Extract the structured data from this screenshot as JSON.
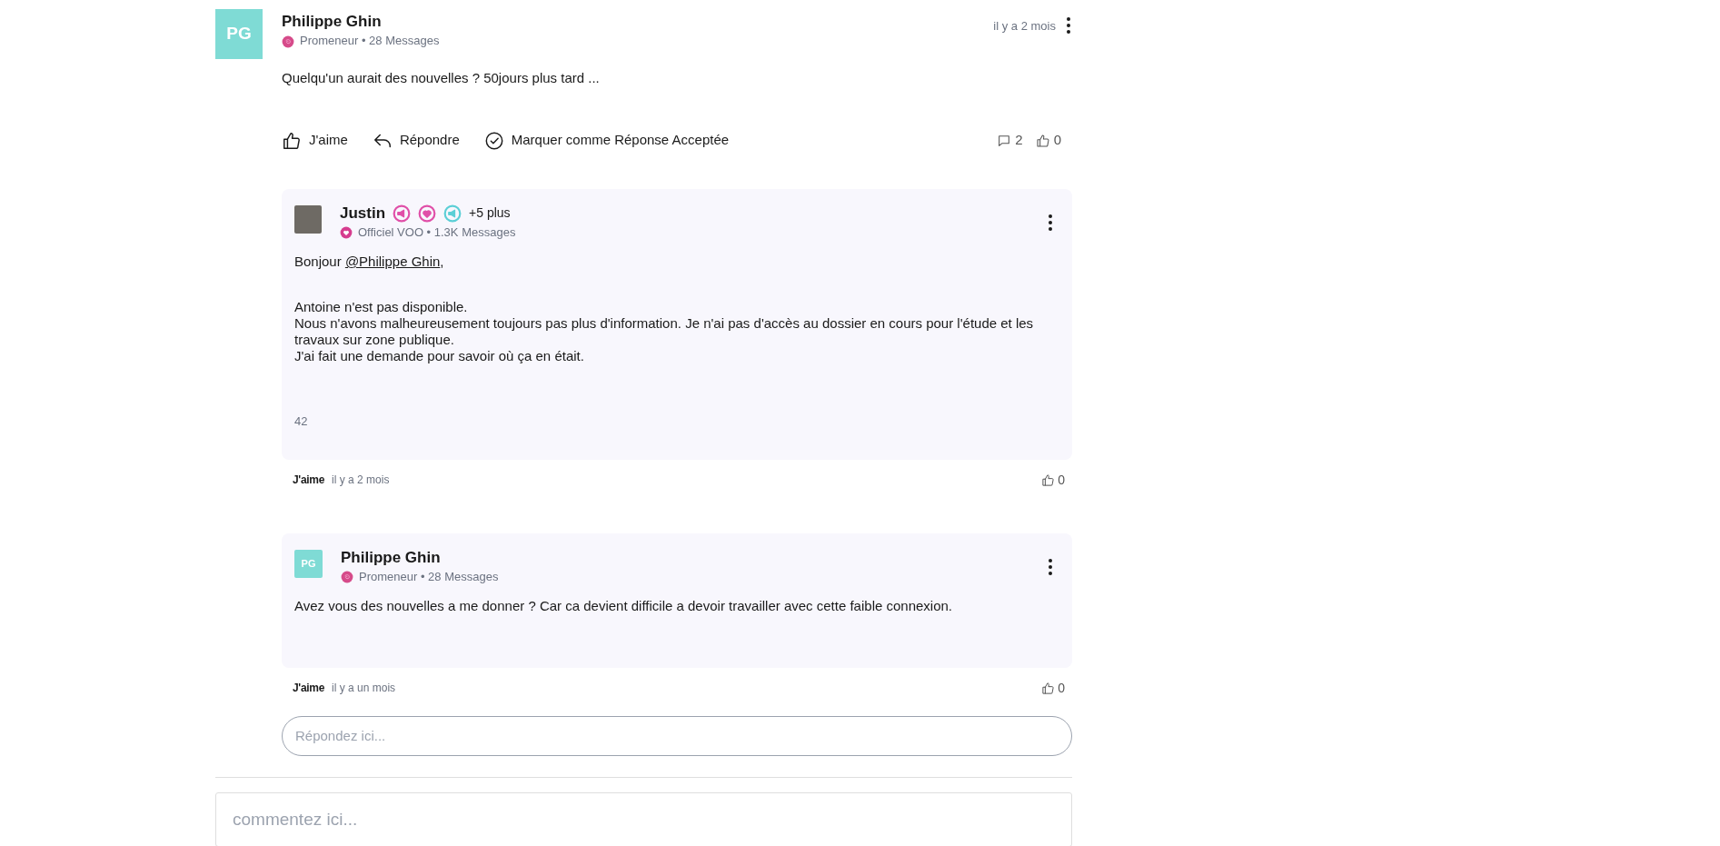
{
  "post": {
    "avatar_initials": "PG",
    "author": "Philippe Ghin",
    "role": "Promeneur • 28 Messages",
    "time": "il y a 2 mois",
    "text": "Quelqu'un aurait des nouvelles ? 50jours plus tard ...",
    "actions": [
      {
        "kind": "like",
        "label": "J'aime"
      },
      {
        "kind": "reply",
        "label": "Répondre"
      },
      {
        "kind": "accept",
        "label": "Marquer comme Réponse Acceptée"
      }
    ],
    "comment_count": "2",
    "like_count": "0"
  },
  "replies": [
    {
      "avatar": {
        "kind": "photo"
      },
      "author": "Justin",
      "badges": [
        {
          "kind": "megaphone",
          "color": "#e04fa8"
        },
        {
          "kind": "heart",
          "color": "#e04fa8"
        },
        {
          "kind": "megaphone",
          "color": "#5ccfd6"
        }
      ],
      "more_badges": "+5 plus",
      "rank_badge": {
        "kind": "heart"
      },
      "role": "Officiel VOO • 1.3K Messages",
      "greeting": {
        "before": "Bonjour ",
        "mention": "@Philippe Ghin",
        "after": ","
      },
      "lines": [
        "Antoine n'est pas disponible.",
        "Nous n'avons malheureusement toujours pas plus d'information. Je n'ai pas d'accès au dossier en cours pour l'étude et les travaux sur zone publique.",
        "J'ai fait une demande pour savoir où ça en était."
      ],
      "note": "42",
      "like_label": "J'aime",
      "time": "il y a 2 mois",
      "like_count": "0"
    },
    {
      "avatar": {
        "kind": "initials",
        "initials": "PG"
      },
      "author": "Philippe Ghin",
      "rank_badge": {
        "kind": "swirl"
      },
      "role": "Promeneur • 28 Messages",
      "lines": [
        "Avez vous des nouvelles a me donner ? Car ca devient difficile a devoir travailler avec cette faible connexion."
      ],
      "like_label": "J'aime",
      "time": "il y a un mois",
      "like_count": "0"
    }
  ],
  "reply_field": {
    "placeholder": "Répondez ici..."
  },
  "comment_field": {
    "placeholder": "commentez ici..."
  }
}
